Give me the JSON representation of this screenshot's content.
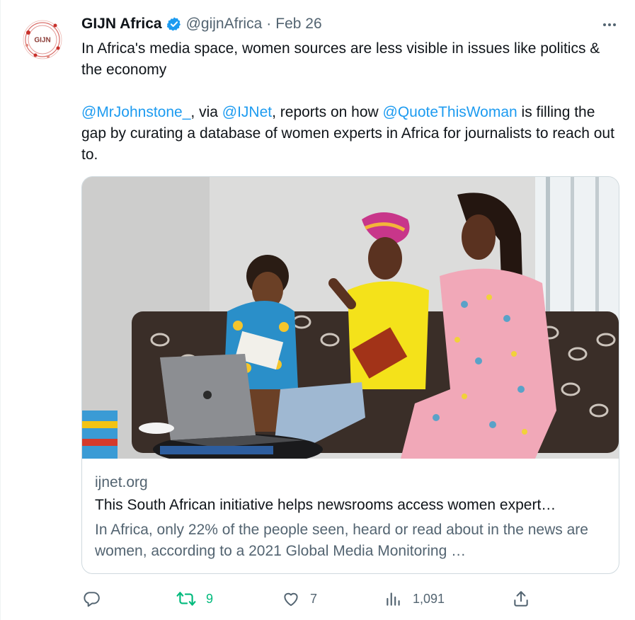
{
  "tweet": {
    "author_name": "GIJN Africa",
    "handle": "@gijnAfrica",
    "separator": "·",
    "date": "Feb 26",
    "avatar_text": "GIJN",
    "text_line1": "In Africa's media space, women sources are less visible in issues like politics & the economy",
    "mention1": "@MrJohnstone_",
    "text_seg1": ", via ",
    "mention2": "@IJNet",
    "text_seg2": ", reports on how ",
    "mention3": "@QuoteThisWoman",
    "text_seg3": " is filling the gap by curating a database of women experts in Africa for journalists to reach out to."
  },
  "card": {
    "domain": "ijnet.org",
    "title": "This South African initiative helps newsrooms access women expert…",
    "description": "In Africa, only 22% of the people seen, heard or read about in the news are women, according to a 2021 Global Media Monitoring …"
  },
  "actions": {
    "replies": "",
    "retweets": "9",
    "likes": "7",
    "views": "1,091"
  },
  "colors": {
    "accent": "#1d9bf0",
    "retweet_green": "#00ba7c",
    "secondary_text": "#536471",
    "brand_red": "#c8312b"
  },
  "icons": [
    "verified-badge-icon",
    "more-icon",
    "reply-icon",
    "retweet-icon",
    "like-icon",
    "views-icon",
    "share-icon"
  ]
}
